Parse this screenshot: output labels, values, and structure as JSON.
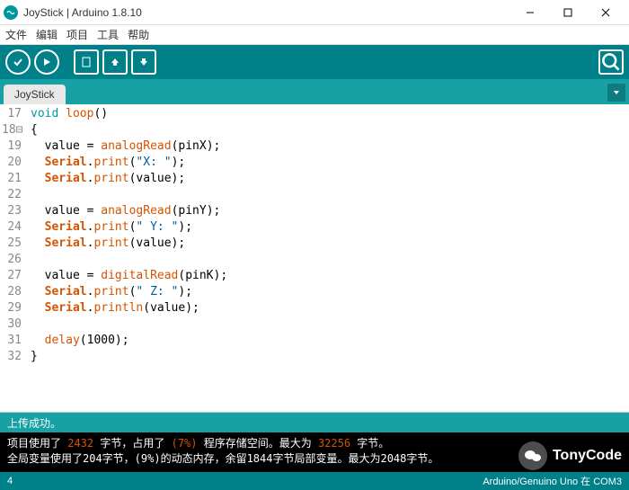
{
  "window": {
    "title": "JoyStick | Arduino 1.8.10"
  },
  "menu": {
    "file": "文件",
    "edit": "编辑",
    "sketch": "项目",
    "tools": "工具",
    "help": "帮助"
  },
  "tab": {
    "name": "JoyStick"
  },
  "code": {
    "lines": [
      {
        "n": "17",
        "t": "void loop()",
        "tokens": [
          [
            "void",
            "k-type"
          ],
          [
            " ",
            ""
          ],
          [
            "loop",
            "k-fn"
          ],
          [
            "()",
            "k-paren"
          ]
        ]
      },
      {
        "n": "18",
        "t": "{",
        "marker": "⊟",
        "tokens": [
          [
            "{",
            "k-paren"
          ]
        ]
      },
      {
        "n": "19",
        "t": "  value = analogRead(pinX);",
        "tokens": [
          [
            "  value = ",
            ""
          ],
          [
            "analogRead",
            "k-fn"
          ],
          [
            "(pinX);",
            "k-paren"
          ]
        ]
      },
      {
        "n": "20",
        "t": "  Serial.print(\"X: \");",
        "tokens": [
          [
            "  ",
            ""
          ],
          [
            "Serial",
            "k-obj"
          ],
          [
            ".",
            ""
          ],
          [
            "print",
            "k-fn"
          ],
          [
            "(",
            "k-paren"
          ],
          [
            "\"X: \"",
            "k-str"
          ],
          [
            ");",
            "k-paren"
          ]
        ]
      },
      {
        "n": "21",
        "t": "  Serial.print(value);",
        "tokens": [
          [
            "  ",
            ""
          ],
          [
            "Serial",
            "k-obj"
          ],
          [
            ".",
            ""
          ],
          [
            "print",
            "k-fn"
          ],
          [
            "(value);",
            "k-paren"
          ]
        ]
      },
      {
        "n": "22",
        "t": ""
      },
      {
        "n": "23",
        "t": "  value = analogRead(pinY);",
        "tokens": [
          [
            "  value = ",
            ""
          ],
          [
            "analogRead",
            "k-fn"
          ],
          [
            "(pinY);",
            "k-paren"
          ]
        ]
      },
      {
        "n": "24",
        "t": "  Serial.print(\" Y: \");",
        "tokens": [
          [
            "  ",
            ""
          ],
          [
            "Serial",
            "k-obj"
          ],
          [
            ".",
            ""
          ],
          [
            "print",
            "k-fn"
          ],
          [
            "(",
            "k-paren"
          ],
          [
            "\" Y: \"",
            "k-str"
          ],
          [
            ");",
            "k-paren"
          ]
        ]
      },
      {
        "n": "25",
        "t": "  Serial.print(value);",
        "tokens": [
          [
            "  ",
            ""
          ],
          [
            "Serial",
            "k-obj"
          ],
          [
            ".",
            ""
          ],
          [
            "print",
            "k-fn"
          ],
          [
            "(value);",
            "k-paren"
          ]
        ]
      },
      {
        "n": "26",
        "t": ""
      },
      {
        "n": "27",
        "t": "  value = digitalRead(pinK);",
        "tokens": [
          [
            "  value = ",
            ""
          ],
          [
            "digitalRead",
            "k-fn"
          ],
          [
            "(pinK);",
            "k-paren"
          ]
        ]
      },
      {
        "n": "28",
        "t": "  Serial.print(\" Z: \");",
        "tokens": [
          [
            "  ",
            ""
          ],
          [
            "Serial",
            "k-obj"
          ],
          [
            ".",
            ""
          ],
          [
            "print",
            "k-fn"
          ],
          [
            "(",
            "k-paren"
          ],
          [
            "\" Z: \"",
            "k-str"
          ],
          [
            ");",
            "k-paren"
          ]
        ]
      },
      {
        "n": "29",
        "t": "  Serial.println(value);",
        "tokens": [
          [
            "  ",
            ""
          ],
          [
            "Serial",
            "k-obj"
          ],
          [
            ".",
            ""
          ],
          [
            "println",
            "k-fn"
          ],
          [
            "(value);",
            "k-paren"
          ]
        ]
      },
      {
        "n": "30",
        "t": ""
      },
      {
        "n": "31",
        "t": "  delay(1000);",
        "tokens": [
          [
            "  ",
            ""
          ],
          [
            "delay",
            "k-fn"
          ],
          [
            "(1000);",
            "k-paren"
          ]
        ]
      },
      {
        "n": "32",
        "t": "}",
        "tokens": [
          [
            "}",
            "k-paren"
          ]
        ]
      }
    ]
  },
  "status": {
    "message": "上传成功。"
  },
  "console": {
    "line1_pre": "项目使用了 ",
    "line1_val1": "2432",
    "line1_mid": " 字节，占用了 ",
    "line1_val2": "(7%)",
    "line1_mid2": " 程序存储空间。最大为 ",
    "line1_val3": "32256",
    "line1_post": " 字节。",
    "line2": "全局变量使用了204字节，(9%)的动态内存，余留1844字节局部变量。最大为2048字节。"
  },
  "footer": {
    "left": "4",
    "right": "Arduino/Genuino Uno 在 COM3"
  },
  "watermark": {
    "text": "TonyCode"
  }
}
